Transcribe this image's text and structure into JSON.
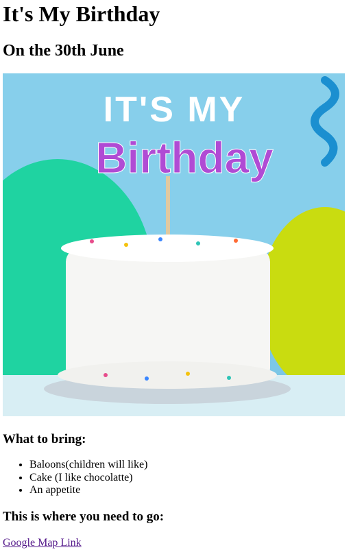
{
  "heading": "It's My Birthday",
  "subheading": "On the 30th June",
  "image": {
    "line1": "IT'S MY",
    "line2": "Birthday",
    "colors": {
      "sky": "#7cc7e6",
      "balloon_green": "#1fd3a1",
      "balloon_yellow": "#c9dc10",
      "ribbon_blue": "#1b8fd0",
      "cake": "#f6f6f4",
      "plate": "#c9d4dc"
    }
  },
  "bring_heading": "What to bring:",
  "bring_items": [
    "Baloons(children will like)",
    "Cake (I like chocolatte)",
    "An appetite"
  ],
  "go_heading": "This is where you need to go:",
  "map_link": "Google Map Link"
}
